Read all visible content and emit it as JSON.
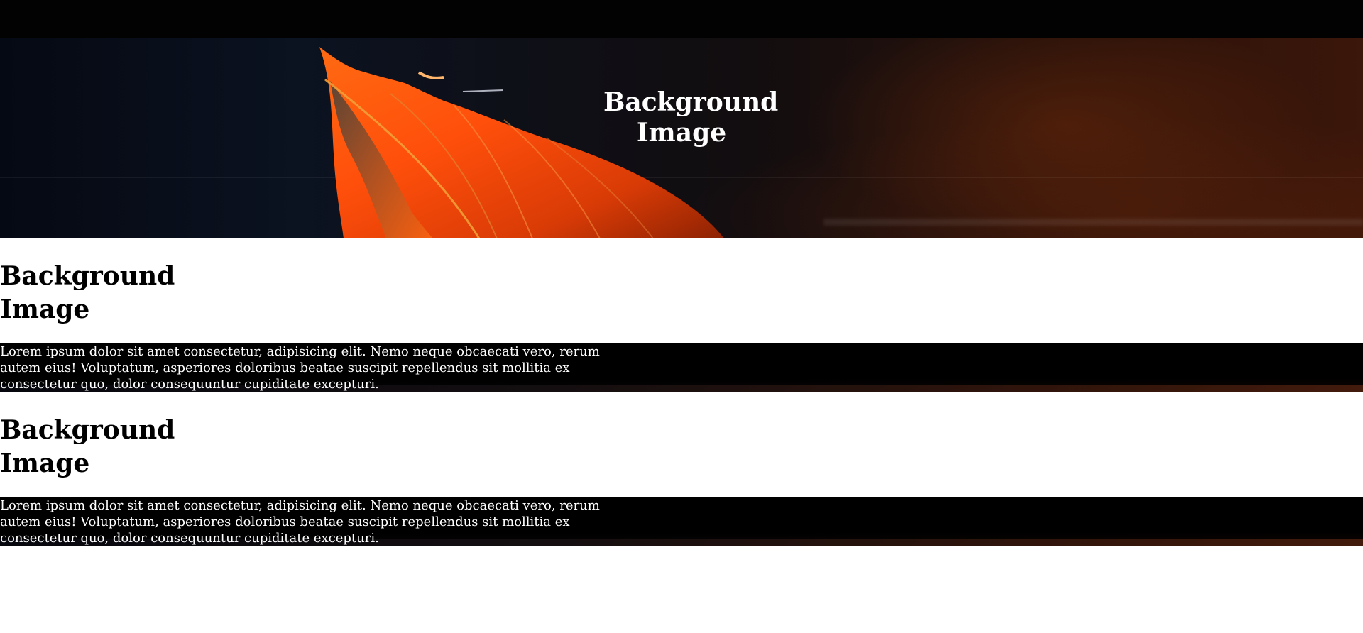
{
  "hero": {
    "title": "Background Image"
  },
  "sections": [
    {
      "title": "Background Image",
      "text": "Lorem ipsum dolor sit amet consectetur, adipisicing elit. Nemo neque obcaecati vero, rerum autem eius! Voluptatum, asperiores doloribus beatae suscipit repellendus sit mollitia ex consectetur quo, dolor consequuntur cupiditate excepturi."
    },
    {
      "title": "Background Image",
      "text": "Lorem ipsum dolor sit amet consectetur, adipisicing elit. Nemo neque obcaecati vero, rerum autem eius! Voluptatum, asperiores doloribus beatae suscipit repellendus sit mollitia ex consectetur quo, dolor consequuntur cupiditate excepturi."
    }
  ],
  "colors": {
    "leaf": "#ff5a12",
    "background_dark": "#050913",
    "wood": "#3b160a",
    "text_light": "#ffffff",
    "text_dark": "#000000"
  }
}
